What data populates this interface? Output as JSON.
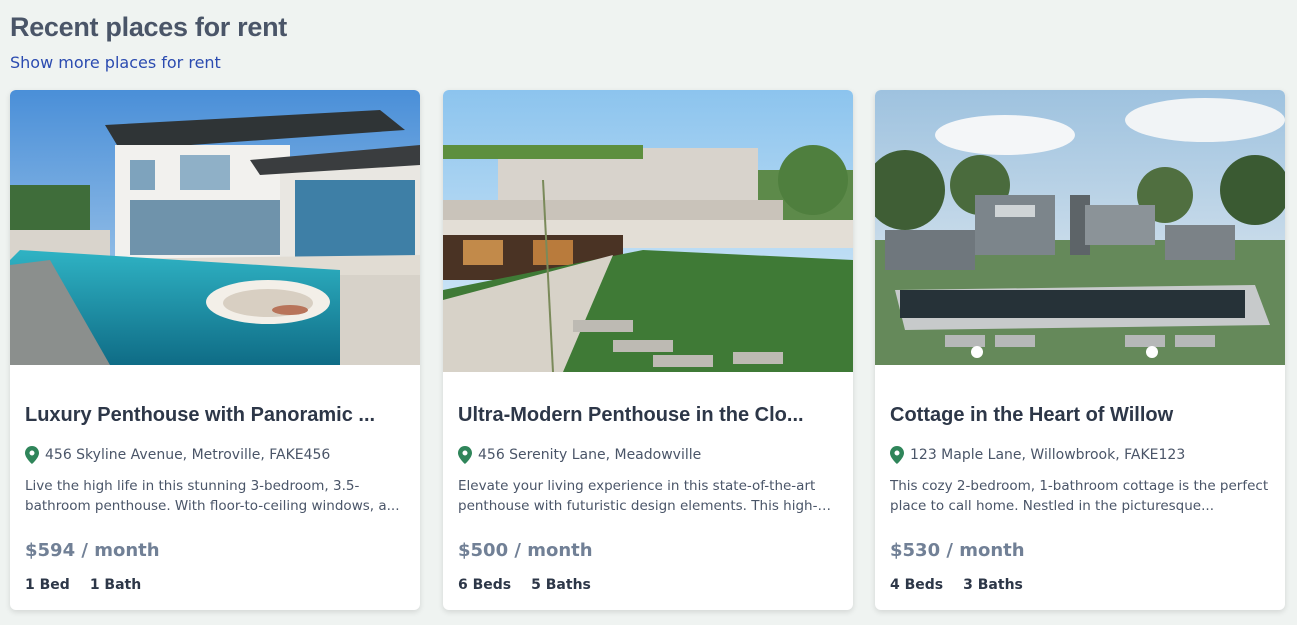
{
  "section": {
    "heading": "Recent places for rent",
    "more_link": "Show more places for rent"
  },
  "colors": {
    "background": "#eff3f1",
    "link": "#2b4bb0",
    "pin": "#2f855a"
  },
  "listings": [
    {
      "title": "Luxury Penthouse with Panoramic ...",
      "address": "456 Skyline Avenue, Metroville, FAKE456",
      "description": "Live the high life in this stunning 3-bedroom, 3.5-bathroom penthouse. With floor-to-ceiling windows, a...",
      "price": "$594 / month",
      "beds": "1 Bed",
      "baths": "1 Bath"
    },
    {
      "title": "Ultra-Modern Penthouse in the Clo...",
      "address": "456 Serenity Lane, Meadowville",
      "description": "Elevate your living experience in this state-of-the-art penthouse with futuristic design elements. This high-tec...",
      "price": "$500 / month",
      "beds": "6 Beds",
      "baths": "5 Baths"
    },
    {
      "title": "Cottage in the Heart of Willow",
      "address": "123 Maple Lane, Willowbrook, FAKE123",
      "description": "This cozy 2-bedroom, 1-bathroom cottage is the perfect place to call home. Nestled in the picturesque...",
      "price": "$530 / month",
      "beds": "4 Beds",
      "baths": "3 Baths"
    }
  ]
}
